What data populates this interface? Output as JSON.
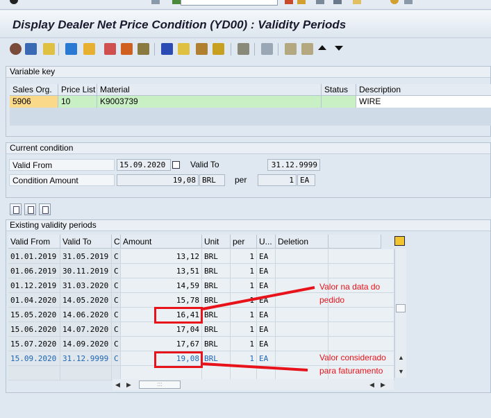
{
  "title": "Display Dealer Net Price Condition (YD00) : Validity Periods",
  "variable_key": {
    "group_title": "Variable key",
    "headers": [
      "Sales Org.",
      "Price List",
      "Material",
      "Status",
      "Description"
    ],
    "row": [
      "5906",
      "10",
      "K9003739",
      "",
      "WIRE"
    ]
  },
  "current_condition": {
    "group_title": "Current condition",
    "valid_from_label": "Valid From",
    "valid_from": "15.09.2020",
    "valid_to_label": "Valid To",
    "valid_to": "31.12.9999",
    "amount_label": "Condition Amount",
    "amount": "19,08",
    "currency": "BRL",
    "per_label": "per",
    "per": "1",
    "unit": "EA"
  },
  "periods": {
    "group_title": "Existing validity periods",
    "headers": [
      "Valid From",
      "Valid To",
      "C",
      "Amount",
      "Unit",
      "per",
      "U...",
      "Deletion"
    ],
    "rows": [
      [
        "01.01.2019",
        "31.05.2019",
        "C",
        "13,12",
        "BRL",
        "1",
        "EA",
        ""
      ],
      [
        "01.06.2019",
        "30.11.2019",
        "C",
        "13,51",
        "BRL",
        "1",
        "EA",
        ""
      ],
      [
        "01.12.2019",
        "31.03.2020",
        "C",
        "14,59",
        "BRL",
        "1",
        "EA",
        ""
      ],
      [
        "01.04.2020",
        "14.05.2020",
        "C",
        "15,78",
        "BRL",
        "1",
        "EA",
        ""
      ],
      [
        "15.05.2020",
        "14.06.2020",
        "C",
        "16,41",
        "BRL",
        "1",
        "EA",
        ""
      ],
      [
        "15.06.2020",
        "14.07.2020",
        "C",
        "17,04",
        "BRL",
        "1",
        "EA",
        ""
      ],
      [
        "15.07.2020",
        "14.09.2020",
        "C",
        "17,67",
        "BRL",
        "1",
        "EA",
        ""
      ],
      [
        "15.09.2020",
        "31.12.9999",
        "C",
        "19,08",
        "BRL",
        "1",
        "EA",
        ""
      ]
    ]
  },
  "annotations": {
    "note1_line1": "Valor na data do",
    "note1_line2": "pedido",
    "note2_line1": "Valor considerado",
    "note2_line2": "para faturamento"
  },
  "colors": {
    "accent_red": "#e8121a",
    "key_field": "#fbd98a",
    "data_field": "#c9f0c4",
    "selected_text": "#1c64b4"
  }
}
